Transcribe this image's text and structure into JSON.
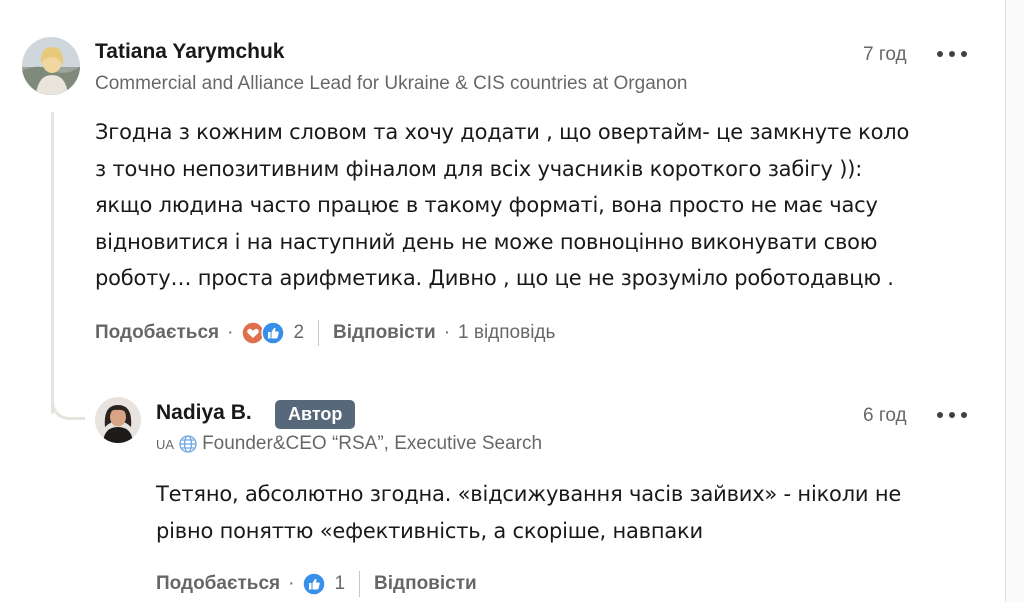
{
  "comment": {
    "author_name": "Tatiana Yarymchuk",
    "headline": "Commercial and Alliance Lead for Ukraine & CIS countries at Organon",
    "time": "7 год",
    "more_icon": "more-horizontal-icon",
    "body_lines": [
      "Згодна з кожним словом та хочу додати , що овертайм- це замкнуте коло",
      "з точно непозитивним фіналом для всіх учасників короткого забігу )):",
      "якщо людина часто працює в такому форматі, вона просто не має часу",
      "відновитися і на наступний день не може повноцінно виконувати свою",
      "роботу… проста арифметика. Дивно , що це не зрозуміло роботодавцю ."
    ],
    "like_label": "Подобається",
    "reaction_icons": [
      "love-reaction-icon",
      "like-reaction-icon"
    ],
    "reaction_count": "2",
    "reply_label": "Відповісти",
    "reply_count_label": "1 відповідь"
  },
  "reply": {
    "author_name": "Nadiya B.",
    "badge": "Автор",
    "location_code": "UA",
    "headline": "Founder&CEO “RSA”, Executive Search",
    "time": "6 год",
    "more_icon": "more-horizontal-icon",
    "body_lines": [
      "Тетяно, абсолютно згодна. «відсижування часів зайвих» - ніколи не",
      "рівно поняттю «ефективність, а скоріше, навпаки"
    ],
    "like_label": "Подобається",
    "reaction_icons": [
      "like-reaction-icon"
    ],
    "reaction_count": "1",
    "reply_label": "Відповісти"
  },
  "colors": {
    "badge_bg": "#56687a",
    "like_blue": "#378fe9",
    "love_red": "#df704d"
  }
}
